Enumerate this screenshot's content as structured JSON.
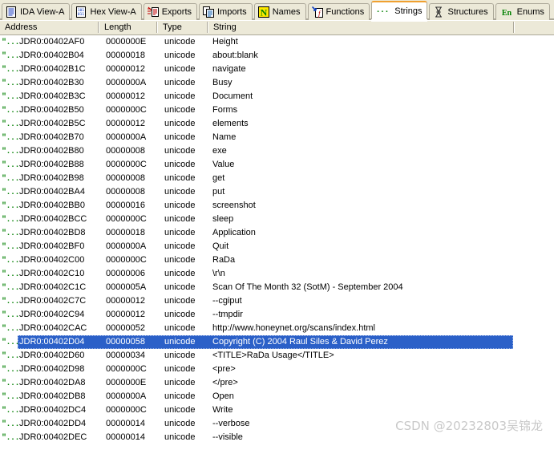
{
  "window": {
    "app": "IDA Pro",
    "view": "Strings window"
  },
  "tabs": [
    {
      "label": "IDA View-A",
      "icon": "document-lines-icon",
      "active": false
    },
    {
      "label": "Hex View-A",
      "icon": "hex-grid-icon",
      "active": false
    },
    {
      "label": "Exports",
      "icon": "exports-arrow-icon",
      "active": false
    },
    {
      "label": "Imports",
      "icon": "imports-arrow-icon",
      "active": false
    },
    {
      "label": "Names",
      "icon": "names-n-icon",
      "active": false
    },
    {
      "label": "Functions",
      "icon": "functions-f-icon",
      "active": false
    },
    {
      "label": "Strings",
      "icon": "strings-quote-icon",
      "active": true
    },
    {
      "label": "Structures",
      "icon": "structures-icon",
      "active": false
    },
    {
      "label": "Enums",
      "icon": "enums-en-icon",
      "active": false
    }
  ],
  "columns": [
    {
      "key": "address",
      "label": "Address"
    },
    {
      "key": "length",
      "label": "Length"
    },
    {
      "key": "type",
      "label": "Type"
    },
    {
      "key": "string",
      "label": "String"
    }
  ],
  "colors": {
    "tabstrip_background": "#ece9d8",
    "active_tab_accent": "#f0a030",
    "selection_background": "#2b60c8",
    "selection_text": "#ffffff",
    "string_icon": "#008000",
    "border": "#aca899",
    "watermark": "#c9c9c9"
  },
  "row_icon_glyph": "\"...\"",
  "rows": [
    {
      "address": "JDR0:00402AF0",
      "length": "0000000E",
      "type": "unicode",
      "string": "Height",
      "selected": false
    },
    {
      "address": "JDR0:00402B04",
      "length": "00000018",
      "type": "unicode",
      "string": "about:blank",
      "selected": false
    },
    {
      "address": "JDR0:00402B1C",
      "length": "00000012",
      "type": "unicode",
      "string": "navigate",
      "selected": false
    },
    {
      "address": "JDR0:00402B30",
      "length": "0000000A",
      "type": "unicode",
      "string": "Busy",
      "selected": false
    },
    {
      "address": "JDR0:00402B3C",
      "length": "00000012",
      "type": "unicode",
      "string": "Document",
      "selected": false
    },
    {
      "address": "JDR0:00402B50",
      "length": "0000000C",
      "type": "unicode",
      "string": "Forms",
      "selected": false
    },
    {
      "address": "JDR0:00402B5C",
      "length": "00000012",
      "type": "unicode",
      "string": "elements",
      "selected": false
    },
    {
      "address": "JDR0:00402B70",
      "length": "0000000A",
      "type": "unicode",
      "string": "Name",
      "selected": false
    },
    {
      "address": "JDR0:00402B80",
      "length": "00000008",
      "type": "unicode",
      "string": "exe",
      "selected": false
    },
    {
      "address": "JDR0:00402B88",
      "length": "0000000C",
      "type": "unicode",
      "string": "Value",
      "selected": false
    },
    {
      "address": "JDR0:00402B98",
      "length": "00000008",
      "type": "unicode",
      "string": "get",
      "selected": false
    },
    {
      "address": "JDR0:00402BA4",
      "length": "00000008",
      "type": "unicode",
      "string": "put",
      "selected": false
    },
    {
      "address": "JDR0:00402BB0",
      "length": "00000016",
      "type": "unicode",
      "string": "screenshot",
      "selected": false
    },
    {
      "address": "JDR0:00402BCC",
      "length": "0000000C",
      "type": "unicode",
      "string": "sleep",
      "selected": false
    },
    {
      "address": "JDR0:00402BD8",
      "length": "00000018",
      "type": "unicode",
      "string": "Application",
      "selected": false
    },
    {
      "address": "JDR0:00402BF0",
      "length": "0000000A",
      "type": "unicode",
      "string": "Quit",
      "selected": false
    },
    {
      "address": "JDR0:00402C00",
      "length": "0000000C",
      "type": "unicode",
      "string": "RaDa",
      "selected": false
    },
    {
      "address": "JDR0:00402C10",
      "length": "00000006",
      "type": "unicode",
      "string": "\\r\\n",
      "selected": false
    },
    {
      "address": "JDR0:00402C1C",
      "length": "0000005A",
      "type": "unicode",
      "string": "Scan Of The Month 32 (SotM) - September 2004",
      "selected": false
    },
    {
      "address": "JDR0:00402C7C",
      "length": "00000012",
      "type": "unicode",
      "string": "--cgiput",
      "selected": false
    },
    {
      "address": "JDR0:00402C94",
      "length": "00000012",
      "type": "unicode",
      "string": "--tmpdir",
      "selected": false
    },
    {
      "address": "JDR0:00402CAC",
      "length": "00000052",
      "type": "unicode",
      "string": "http://www.honeynet.org/scans/index.html",
      "selected": false
    },
    {
      "address": "JDR0:00402D04",
      "length": "00000058",
      "type": "unicode",
      "string": "Copyright (C) 2004 Raul Siles & David Perez",
      "selected": true
    },
    {
      "address": "JDR0:00402D60",
      "length": "00000034",
      "type": "unicode",
      "string": "<TITLE>RaDa Usage</TITLE>",
      "selected": false
    },
    {
      "address": "JDR0:00402D98",
      "length": "0000000C",
      "type": "unicode",
      "string": "<pre>",
      "selected": false
    },
    {
      "address": "JDR0:00402DA8",
      "length": "0000000E",
      "type": "unicode",
      "string": "</pre>",
      "selected": false
    },
    {
      "address": "JDR0:00402DB8",
      "length": "0000000A",
      "type": "unicode",
      "string": "Open",
      "selected": false
    },
    {
      "address": "JDR0:00402DC4",
      "length": "0000000C",
      "type": "unicode",
      "string": "Write",
      "selected": false
    },
    {
      "address": "JDR0:00402DD4",
      "length": "00000014",
      "type": "unicode",
      "string": "--verbose",
      "selected": false
    },
    {
      "address": "JDR0:00402DEC",
      "length": "00000014",
      "type": "unicode",
      "string": "--visible",
      "selected": false
    }
  ],
  "watermark": {
    "text": "CSDN @20232803吴锦龙"
  }
}
